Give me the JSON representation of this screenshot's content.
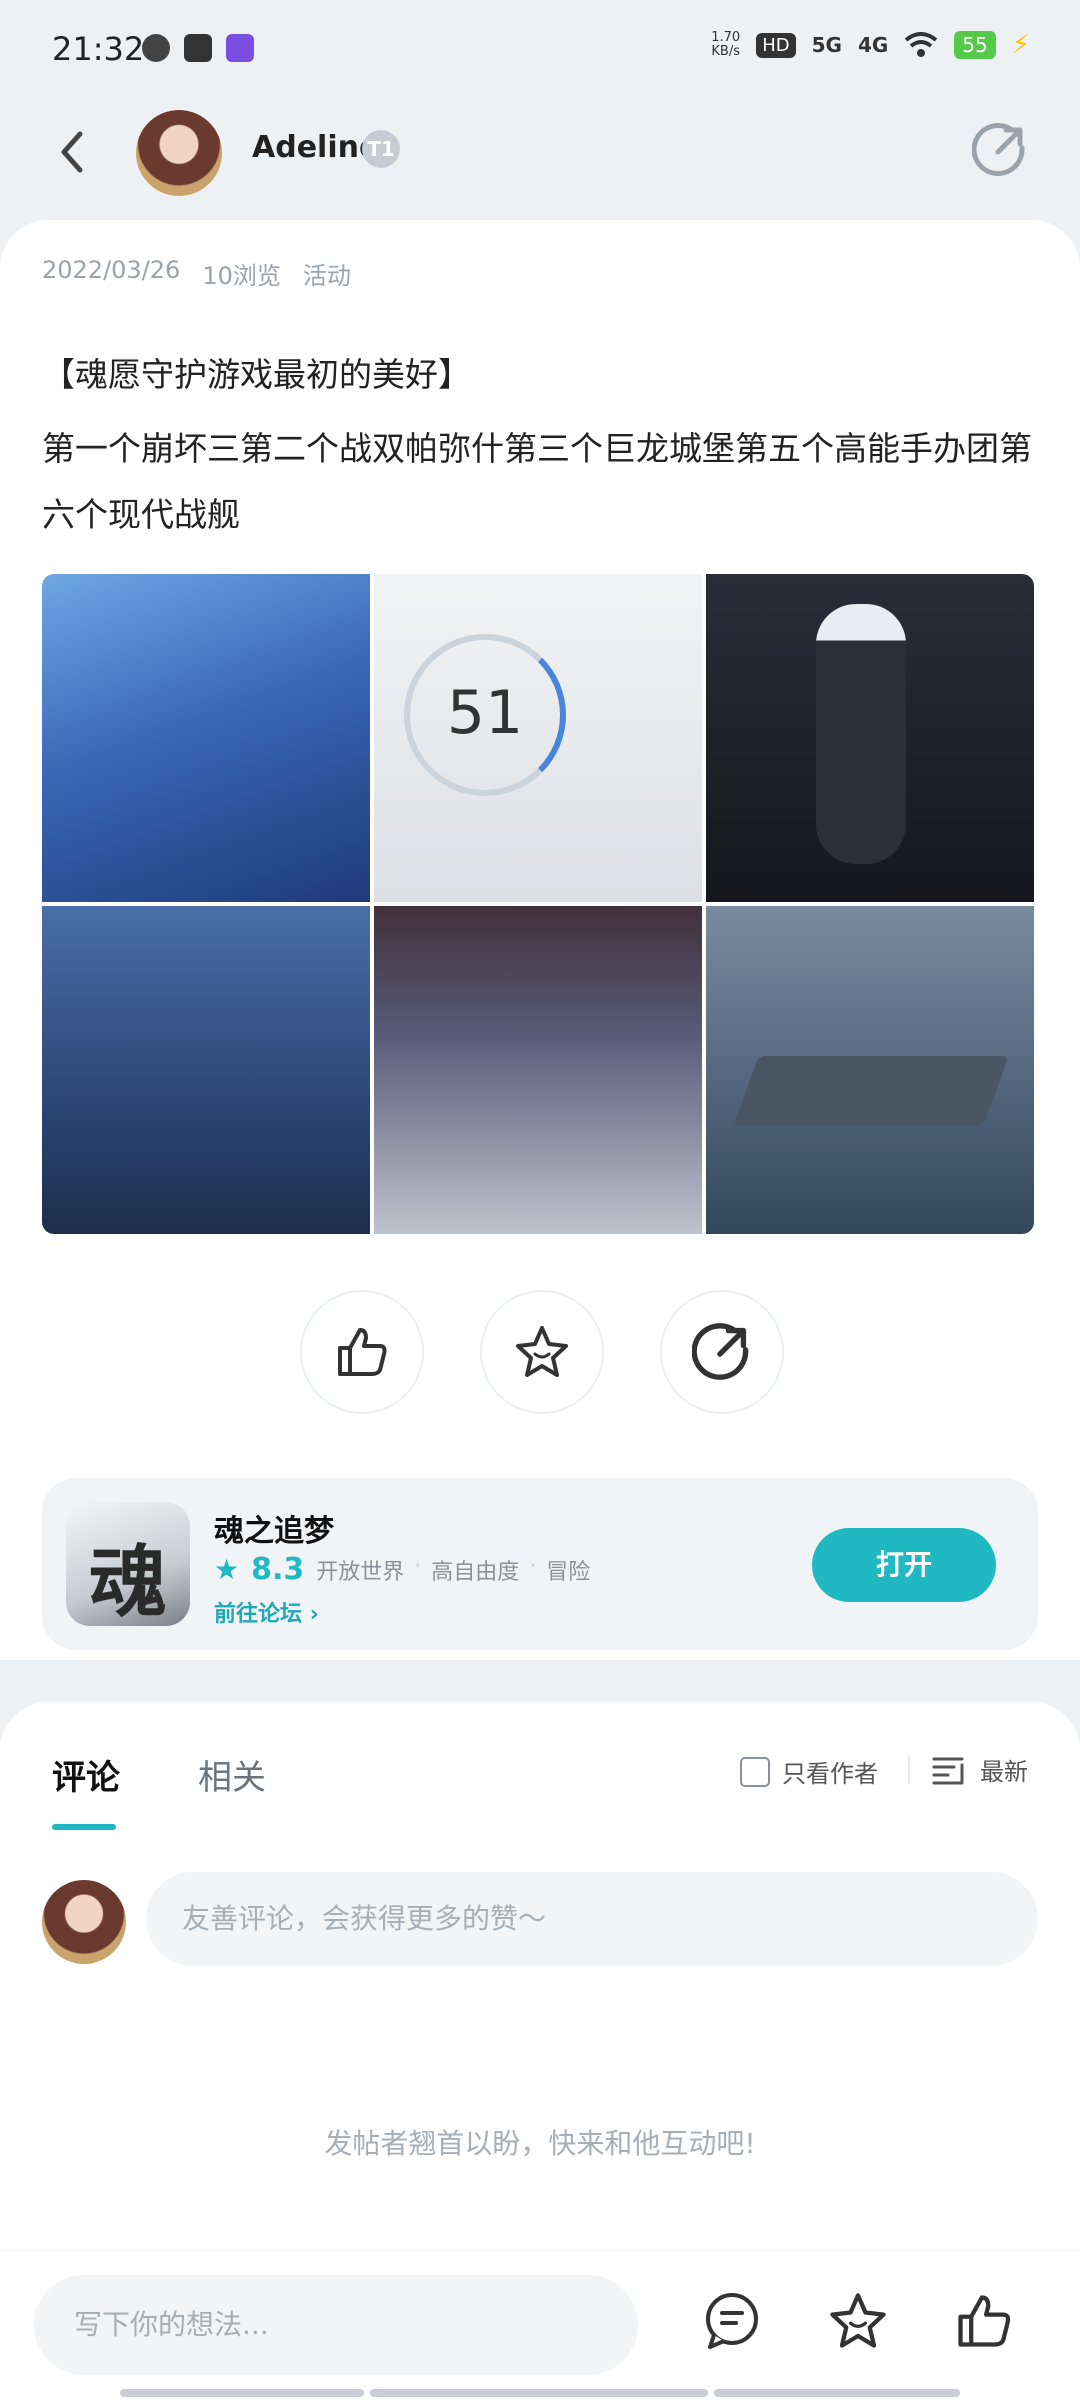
{
  "status_bar": {
    "time": "21:32",
    "net_speed_top": "1.70",
    "net_speed_bottom": "KB/s",
    "hd_label": "HD",
    "net_5g": "5G",
    "net_4g": "4G",
    "battery": "55"
  },
  "header": {
    "author": "Adeline",
    "author_badge": "T1"
  },
  "post": {
    "date": "2022/03/26",
    "views": "10浏览",
    "category": "活动",
    "title": "【魂愿守护游戏最初的美好】",
    "body": "第一个崩坏三第二个战双帕弥什第三个巨龙城堡第五个高能手办团第六个现代战舰",
    "gauge_value": "51"
  },
  "game": {
    "icon_char": "魂",
    "name": "魂之追梦",
    "rating": "8.3",
    "tags": [
      "开放世界",
      "高自由度",
      "冒险"
    ],
    "forum_link": "前往论坛",
    "open_label": "打开"
  },
  "comments": {
    "tab_comment": "评论",
    "tab_related": "相关",
    "only_author": "只看作者",
    "sort_label": "最新",
    "input_placeholder": "友善评论，会获得更多的赞～",
    "empty_note": "发帖者翘首以盼，快来和他互动吧!"
  },
  "bottom_bar": {
    "input_placeholder": "写下你的想法..."
  },
  "colors": {
    "accent": "#1fb8c3",
    "background": "#eef1f4"
  }
}
